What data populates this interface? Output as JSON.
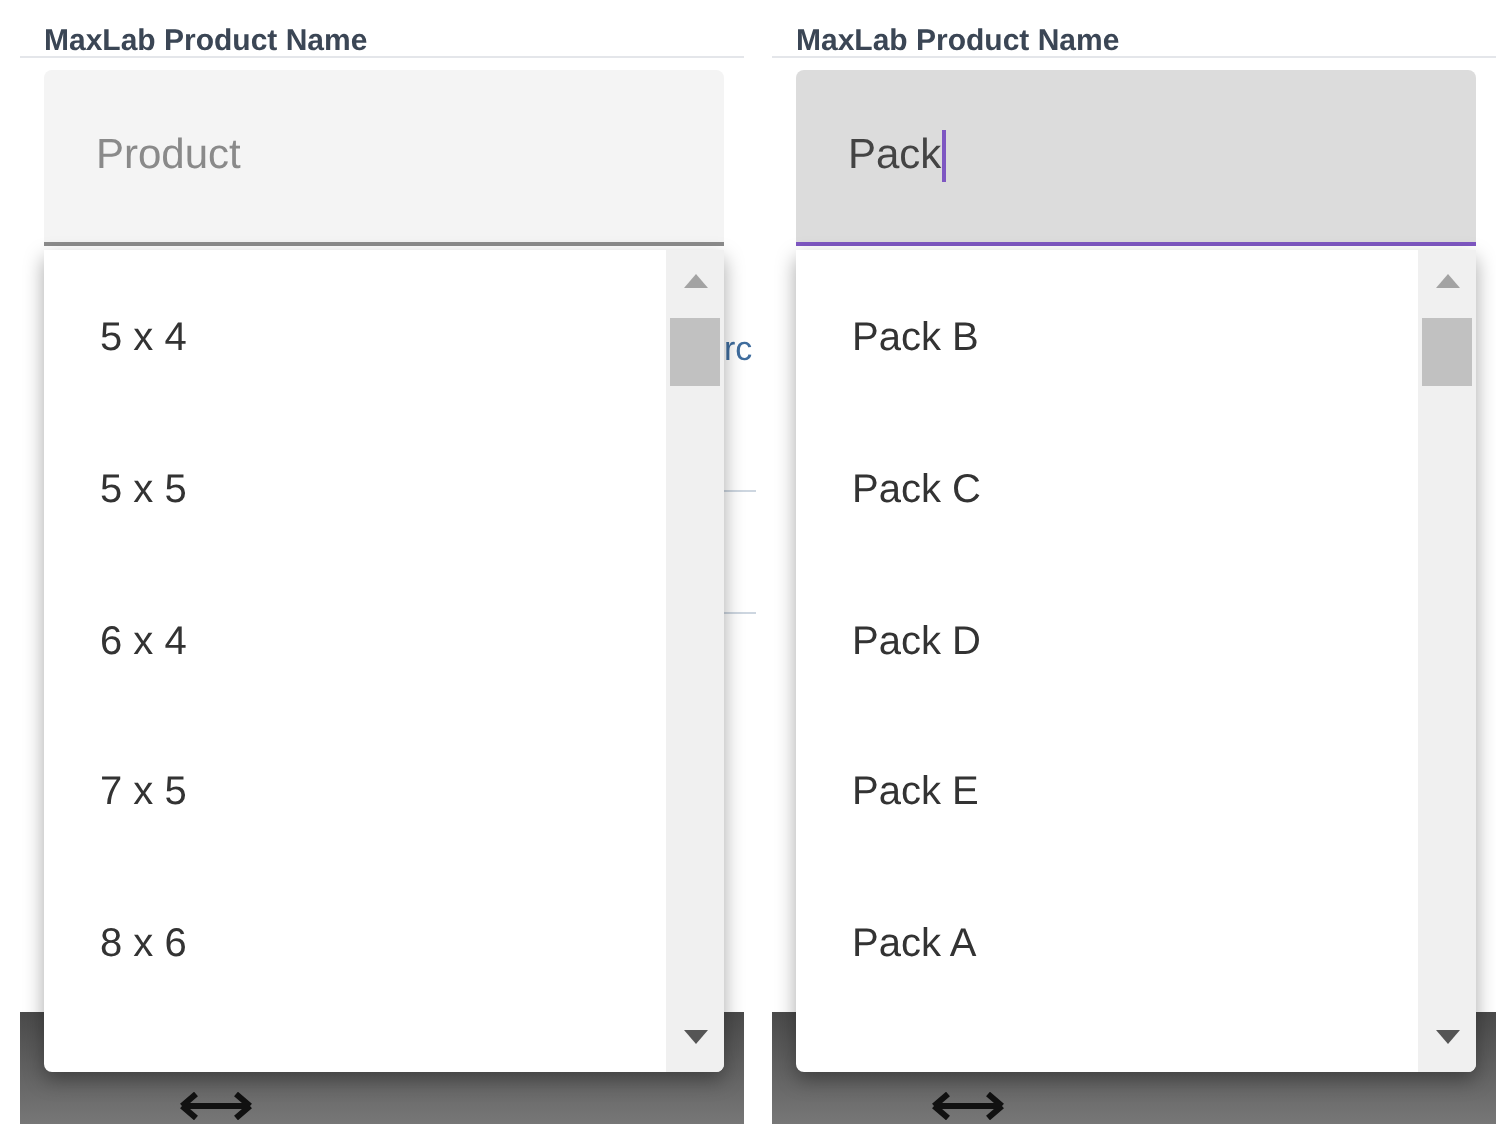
{
  "panels": [
    {
      "label": "MaxLab Product Name",
      "field": {
        "placeholder": "Product",
        "focused": false
      },
      "behind_text": "rc",
      "options": [
        "5 x 4",
        "5 x 5",
        "6 x 4",
        "7 x 5",
        "8 x 6"
      ]
    },
    {
      "label": "MaxLab Product Name",
      "field": {
        "value": "Pack",
        "focused": true
      },
      "options": [
        "Pack B",
        "Pack C",
        "Pack D",
        "Pack E",
        "Pack A"
      ]
    }
  ]
}
